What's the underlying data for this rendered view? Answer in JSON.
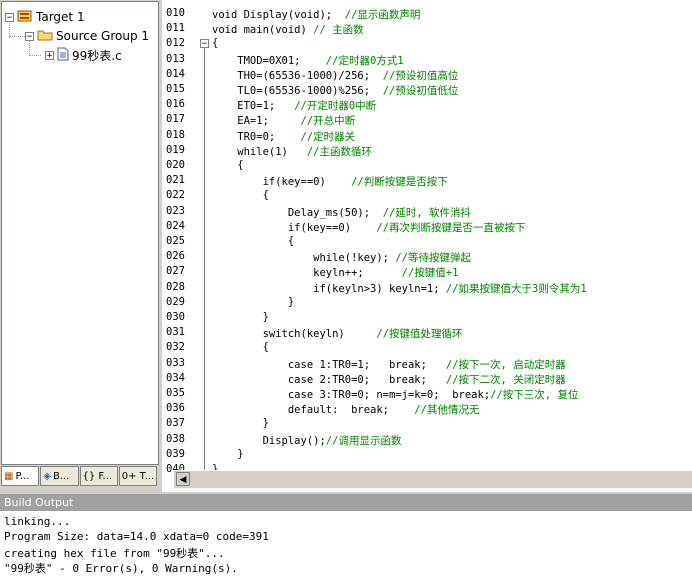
{
  "project": {
    "target": "Target 1",
    "group": "Source Group 1",
    "file": "99秒表.c",
    "tabs": [
      "P...",
      "B...",
      "{} F...",
      "0+ T..."
    ]
  },
  "editor": {
    "lines": [
      {
        "n": "010",
        "t": "void Display(void);  //显示函数声明"
      },
      {
        "n": "011",
        "t": "void main(void) // 主函数"
      },
      {
        "n": "012",
        "t": "{"
      },
      {
        "n": "013",
        "t": "    TMOD=0X01;    //定时器0方式1"
      },
      {
        "n": "014",
        "t": "    TH0=(65536-1000)/256;  //预设初值高位"
      },
      {
        "n": "015",
        "t": "    TL0=(65536-1000)%256;  //预设初值低位"
      },
      {
        "n": "016",
        "t": "    ET0=1;   //开定时器0中断"
      },
      {
        "n": "017",
        "t": "    EA=1;     //开总中断"
      },
      {
        "n": "018",
        "t": "    TR0=0;    //定时器关"
      },
      {
        "n": "019",
        "t": "    while(1)   //主函数循环"
      },
      {
        "n": "020",
        "t": "    {"
      },
      {
        "n": "021",
        "t": "        if(key==0)    //判断按键是否按下"
      },
      {
        "n": "022",
        "t": "        {"
      },
      {
        "n": "023",
        "t": "            Delay_ms(50);  //延时, 软件消抖"
      },
      {
        "n": "024",
        "t": "            if(key==0)    //再次判断按键是否一直被按下"
      },
      {
        "n": "025",
        "t": "            {"
      },
      {
        "n": "026",
        "t": "                while(!key); //等待按键弹起"
      },
      {
        "n": "027",
        "t": "                keyln++;      //按键值+1"
      },
      {
        "n": "028",
        "t": "                if(keyln>3) keyln=1; //如果按键值大于3则令其为1"
      },
      {
        "n": "029",
        "t": "            }"
      },
      {
        "n": "030",
        "t": "        }"
      },
      {
        "n": "031",
        "t": "        switch(keyln)     //按键值处理循环"
      },
      {
        "n": "032",
        "t": "        {"
      },
      {
        "n": "033",
        "t": "            case 1:TR0=1;   break;   //按下一次, 启动定时器"
      },
      {
        "n": "034",
        "t": "            case 2:TR0=0;   break;   //按下二次, 关闭定时器"
      },
      {
        "n": "035",
        "t": "            case 3:TR0=0; n=m=j=k=0;  break;//按下三次, 复位"
      },
      {
        "n": "036",
        "t": "            default:  break;    //其他情况无"
      },
      {
        "n": "037",
        "t": "        }"
      },
      {
        "n": "038",
        "t": "        Display();//调用显示函数"
      },
      {
        "n": "039",
        "t": "    }"
      },
      {
        "n": "040",
        "t": "}"
      }
    ]
  },
  "build": {
    "title": "Build Output",
    "lines": [
      "linking...",
      "Program Size: data=14.0 xdata=0 code=391",
      "creating hex file from \"99秒表\"...",
      "\"99秒表\" - 0 Error(s), 0 Warning(s)."
    ]
  }
}
